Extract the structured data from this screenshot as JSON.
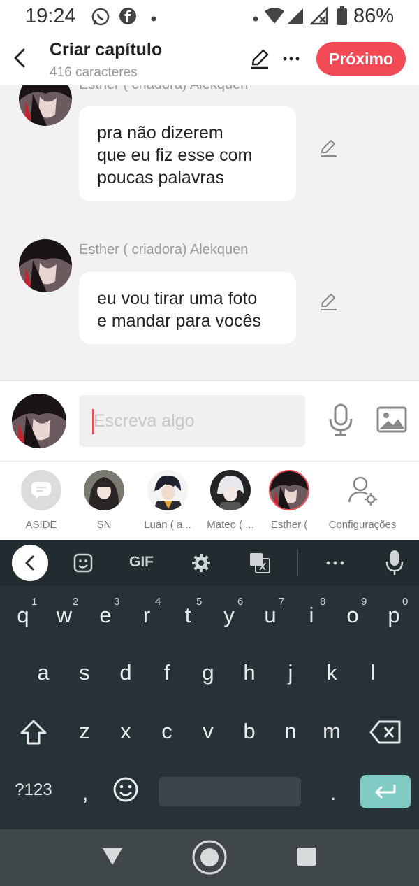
{
  "status_bar": {
    "time": "19:24",
    "battery": "86%"
  },
  "header": {
    "title": "Criar capítulo",
    "subtitle": "416 caracteres",
    "next_label": "Próximo"
  },
  "messages": [
    {
      "author": "Esther ( criadora) Alekquen",
      "lines": [
        "pra não dizerem",
        "que eu fiz esse com",
        "poucas palavras"
      ]
    },
    {
      "author": "Esther ( criadora) Alekquen",
      "lines": [
        "eu vou tirar uma foto",
        "e mandar para vocês"
      ]
    }
  ],
  "composer": {
    "placeholder": "Escreva algo"
  },
  "characters": [
    {
      "label": "ASIDE"
    },
    {
      "label": "SN"
    },
    {
      "label": "Luan ( a..."
    },
    {
      "label": "Mateo ( ..."
    },
    {
      "label": "Esther ("
    },
    {
      "label": "Configurações"
    }
  ],
  "keyboard": {
    "toolbar": [
      "GIF"
    ],
    "row1": [
      {
        "key": "q",
        "num": "1"
      },
      {
        "key": "w",
        "num": "2"
      },
      {
        "key": "e",
        "num": "3"
      },
      {
        "key": "r",
        "num": "4"
      },
      {
        "key": "t",
        "num": "5"
      },
      {
        "key": "y",
        "num": "6"
      },
      {
        "key": "u",
        "num": "7"
      },
      {
        "key": "i",
        "num": "8"
      },
      {
        "key": "o",
        "num": "9"
      },
      {
        "key": "p",
        "num": "0"
      }
    ],
    "row2": [
      "a",
      "s",
      "d",
      "f",
      "g",
      "h",
      "j",
      "k",
      "l"
    ],
    "row3": [
      "z",
      "x",
      "c",
      "v",
      "b",
      "n",
      "m"
    ],
    "symbols_label": "?123",
    "comma": ",",
    "period": "."
  },
  "colors": {
    "accent": "#f24a55",
    "enter_key": "#80cbc4",
    "keyboard_bg": "#263238"
  }
}
